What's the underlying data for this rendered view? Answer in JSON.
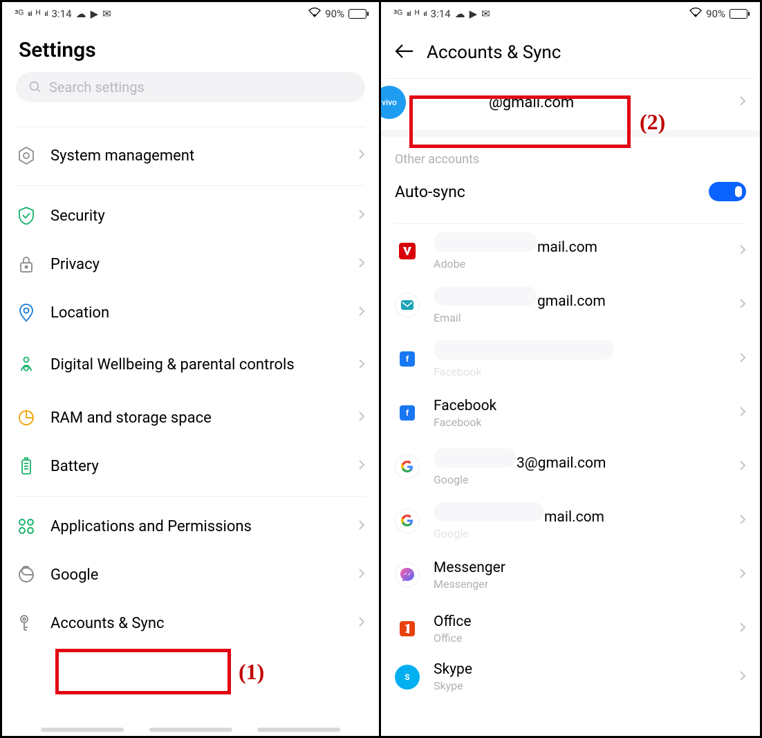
{
  "status": {
    "network_left": "³ᴳ",
    "signal1": "ıııl",
    "network_h": "ᴴ",
    "signal2": "ııl",
    "time": "3:14",
    "wifi_glyph": "�令",
    "battery_pct": "90%"
  },
  "left": {
    "title": "Settings",
    "search_placeholder": "Search settings",
    "rows": {
      "system_mgmt": "System management",
      "security": "Security",
      "privacy": "Privacy",
      "location": "Location",
      "wellbeing": "Digital Wellbeing & parental controls",
      "ram": "RAM and storage space",
      "battery": "Battery",
      "apps_perm": "Applications and Permissions",
      "google": "Google",
      "accounts_sync": "Accounts & Sync"
    },
    "annotation1": "(1)"
  },
  "right": {
    "title": "Accounts & Sync",
    "primary_email": "@gmail.com",
    "section_other": "Other accounts",
    "auto_sync": "Auto-sync",
    "accounts": [
      {
        "primary_suffix": "mail.com",
        "sub": "Adobe",
        "icon": "adobe"
      },
      {
        "primary_suffix": "gmail.com",
        "sub": "Email",
        "icon": "mail"
      },
      {
        "primary_suffix": "",
        "sub": "Facebook",
        "icon": "fb"
      },
      {
        "primary": "Facebook",
        "sub": "Facebook",
        "icon": "fb"
      },
      {
        "primary_suffix": "3@gmail.com",
        "sub": "Google",
        "icon": "g"
      },
      {
        "primary_suffix": "mail.com",
        "sub": "Google",
        "icon": "g"
      },
      {
        "primary": "Messenger",
        "sub": "Messenger",
        "icon": "msgr"
      },
      {
        "primary": "Office",
        "sub": "Office",
        "icon": "office"
      },
      {
        "primary": "Skype",
        "sub": "Skype",
        "icon": "skype"
      }
    ],
    "annotation2": "(2)",
    "vivo_text": "vivo"
  }
}
